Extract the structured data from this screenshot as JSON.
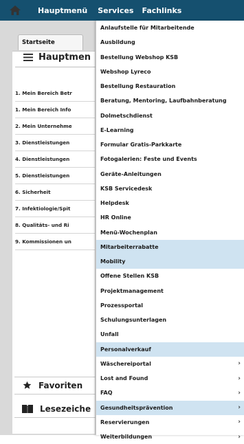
{
  "topbar": {
    "home_icon": "home-icon",
    "nav": [
      {
        "label": "Hauptmenü"
      },
      {
        "label": "Services"
      },
      {
        "label": "Fachlinks"
      }
    ]
  },
  "left": {
    "tab_label": "Startseite",
    "box_title": "Hauptmen",
    "items": [
      {
        "label": "1. Mein Bereich Betr"
      },
      {
        "label": "1. Mein Bereich Info"
      },
      {
        "label": "2. Mein Unternehme"
      },
      {
        "label": "3. Dienstleistungen"
      },
      {
        "label": "4. Dienstleistungen"
      },
      {
        "label": "5. Dienstleistungen"
      },
      {
        "label": "6. Sicherheit"
      },
      {
        "label": "7. Infektiologie/Spit"
      },
      {
        "label": "8. Qualitäts- und Ri"
      },
      {
        "label": "9. Kommissionen un"
      }
    ],
    "favoriten_label": "Favoriten",
    "lesezeichen_label": "Lesezeiche"
  },
  "dropdown": {
    "items": [
      {
        "label": "Anlaufstelle für Mitarbeitende",
        "highlighted": false,
        "submenu": false
      },
      {
        "label": "Ausbildung",
        "highlighted": false,
        "submenu": false
      },
      {
        "label": "Bestellung Webshop KSB",
        "highlighted": false,
        "submenu": false
      },
      {
        "label": "Webshop Lyreco",
        "highlighted": false,
        "submenu": false
      },
      {
        "label": "Bestellung Restauration",
        "highlighted": false,
        "submenu": false
      },
      {
        "label": "Beratung, Mentoring, Laufbahnberatung",
        "highlighted": false,
        "submenu": false
      },
      {
        "label": "Dolmetschdienst",
        "highlighted": false,
        "submenu": false
      },
      {
        "label": "E-Learning",
        "highlighted": false,
        "submenu": false
      },
      {
        "label": "Formular Gratis-Parkkarte",
        "highlighted": false,
        "submenu": false
      },
      {
        "label": "Fotogalerien: Feste und Events",
        "highlighted": false,
        "submenu": false
      },
      {
        "label": "Geräte-Anleitungen",
        "highlighted": false,
        "submenu": false
      },
      {
        "label": "KSB Servicedesk",
        "highlighted": false,
        "submenu": false
      },
      {
        "label": "Helpdesk",
        "highlighted": false,
        "submenu": false
      },
      {
        "label": "HR Online",
        "highlighted": false,
        "submenu": false
      },
      {
        "label": "Menü-Wochenplan",
        "highlighted": false,
        "submenu": false
      },
      {
        "label": "Mitarbeiterrabatte",
        "highlighted": true,
        "submenu": false
      },
      {
        "label": "Mobility",
        "highlighted": true,
        "submenu": false
      },
      {
        "label": "Offene Stellen KSB",
        "highlighted": false,
        "submenu": false
      },
      {
        "label": "Projektmanagement",
        "highlighted": false,
        "submenu": false
      },
      {
        "label": "Prozessportal",
        "highlighted": false,
        "submenu": false
      },
      {
        "label": "Schulungsunterlagen",
        "highlighted": false,
        "submenu": false
      },
      {
        "label": "Unfall",
        "highlighted": false,
        "submenu": false
      },
      {
        "label": "Personalverkauf",
        "highlighted": true,
        "submenu": false
      },
      {
        "label": "Wäschereiportal",
        "highlighted": false,
        "submenu": true
      },
      {
        "label": "Lost and Found",
        "highlighted": false,
        "submenu": true
      },
      {
        "label": "FAQ",
        "highlighted": false,
        "submenu": true
      },
      {
        "label": "Gesundheitsprävention",
        "highlighted": true,
        "submenu": true
      },
      {
        "label": "Reservierungen",
        "highlighted": false,
        "submenu": true
      },
      {
        "label": "Weiterbildungen",
        "highlighted": false,
        "submenu": true
      }
    ]
  },
  "colors": {
    "topbar": "#15506f",
    "highlight": "#cfe3f1",
    "page_bg": "#d9d9d9"
  }
}
